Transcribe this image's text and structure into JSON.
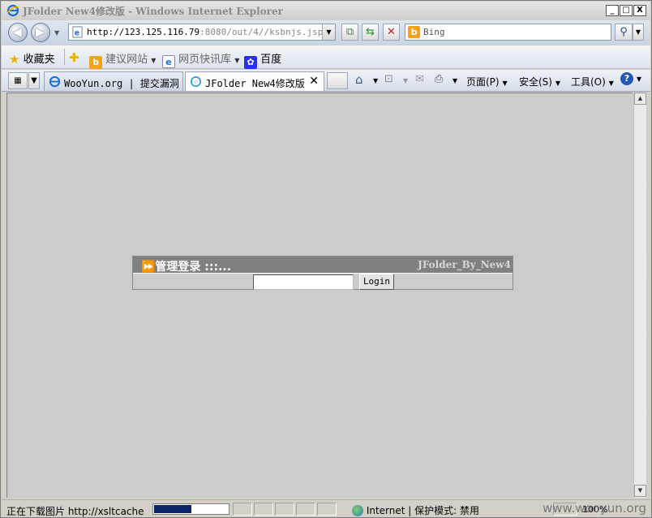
{
  "window": {
    "title": "JFolder New4修改版 - Windows Internet Explorer",
    "controls": [
      "_",
      "□",
      "X"
    ]
  },
  "address": {
    "url_main": "http://123.125.116.79",
    "url_rest": ":8080/out/4//ksbnjs.jsp",
    "search_placeholder": "Bing"
  },
  "favorites": {
    "label": "收藏夹",
    "items": [
      {
        "label": "建议网站",
        "icon": "bing-icon"
      },
      {
        "label": "网页快讯库",
        "icon": "ie-page-icon"
      },
      {
        "label": "百度",
        "icon": "baidu-paw-icon"
      }
    ]
  },
  "tabs": [
    {
      "label": "WooYun.org | 提交漏洞",
      "active": false
    },
    {
      "label": "JFolder New4修改版",
      "active": true
    }
  ],
  "commands": {
    "page": "页面(P)",
    "safety": "安全(S)",
    "tools": "工具(O)"
  },
  "login_panel": {
    "heading": "⏩管理登录 :::...",
    "brand": "JFolder_By_New4",
    "button": "Login",
    "password_value": ""
  },
  "status": {
    "text": "正在下载图片 http://xsltcache",
    "progress": 0.5,
    "zone": "Internet | 保护模式: 禁用",
    "zoom": "100%"
  },
  "watermark": "www.wooyun.org",
  "colors": {
    "content_bg": "#cccccc",
    "panel_header": "#808080",
    "progress_fill": "#0a246a"
  }
}
